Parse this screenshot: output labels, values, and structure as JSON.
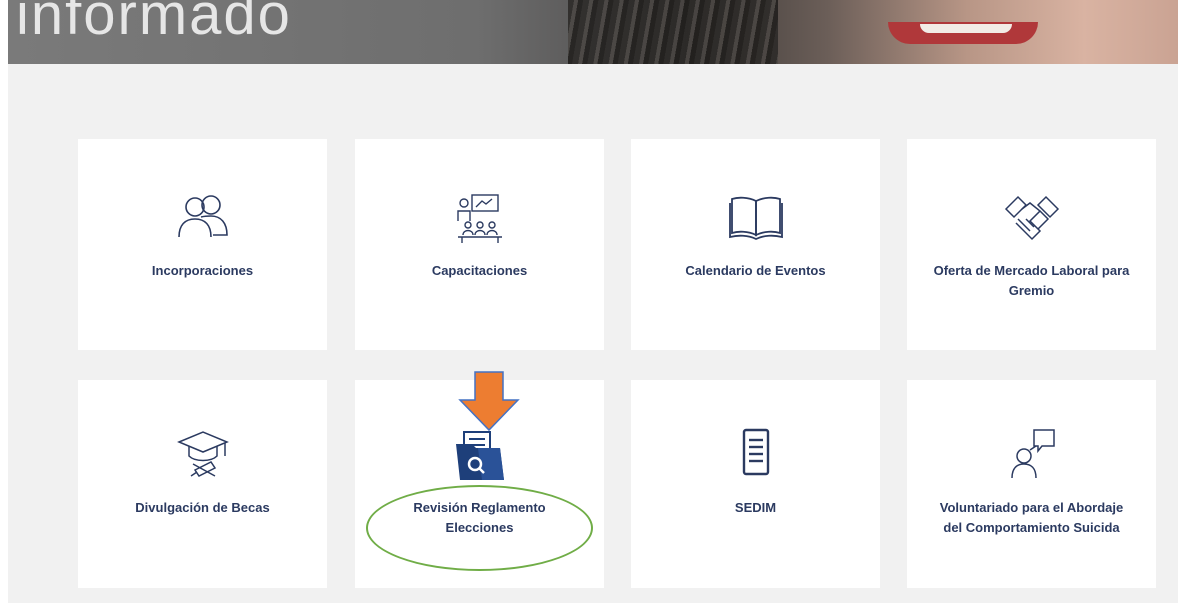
{
  "banner": {
    "title": "informado"
  },
  "cards": [
    {
      "label": "Incorporaciones",
      "icon": "people-icon"
    },
    {
      "label": "Capacitaciones",
      "icon": "classroom-icon"
    },
    {
      "label": "Calendario de Eventos",
      "icon": "open-book-icon"
    },
    {
      "label": "Oferta de Mercado Laboral para Gremio",
      "icon": "handshake-icon"
    },
    {
      "label": "Divulgación de Becas",
      "icon": "graduation-cap-icon"
    },
    {
      "label": "Revisión Reglamento Elecciones",
      "icon": "folder-search-icon"
    },
    {
      "label": "SEDIM",
      "icon": "document-icon"
    },
    {
      "label": "Voluntariado para el Abordaje del Comportamiento Suicida",
      "icon": "person-speech-bubble-icon"
    }
  ],
  "annotations": {
    "arrow_color": "#ed7d31",
    "circle_color": "#70ad47"
  },
  "colors": {
    "card_text": "#2b3a60",
    "icon_stroke": "#2b3a60",
    "folder_icon": "#1e3f7a",
    "page_background": "#f1f1f1"
  }
}
